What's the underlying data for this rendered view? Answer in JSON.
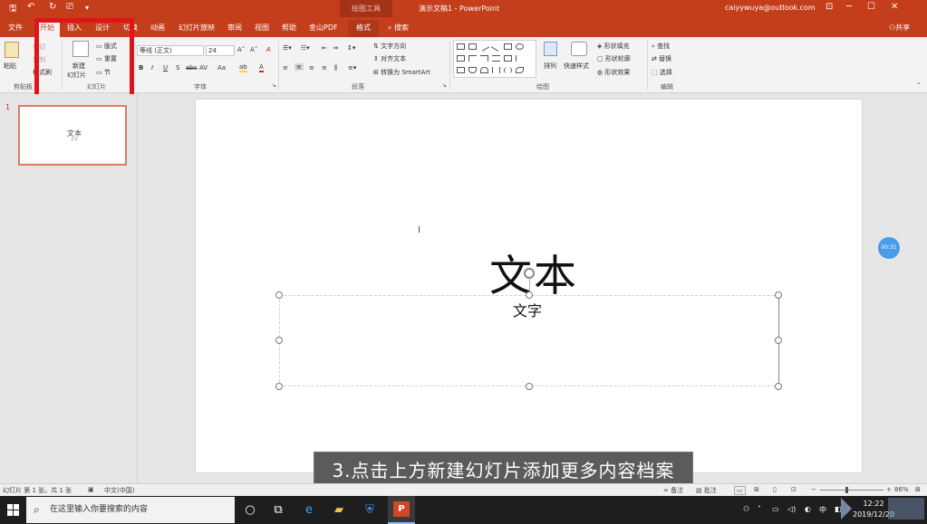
{
  "titlebar": {
    "quick_access": [
      "🖫",
      "↶",
      "↻",
      "⎚",
      "▾"
    ],
    "context_title": "绘图工具",
    "document_title": "演示文稿1 - PowerPoint",
    "account": "caiyywuya@outlook.com",
    "window_buttons": [
      "⊡",
      "─",
      "☐",
      "✕"
    ]
  },
  "tabs": {
    "file": "文件",
    "home": "开始",
    "insert": "插入",
    "design": "设计",
    "transitions": "切换",
    "animations": "动画",
    "slideshow": "幻灯片放映",
    "review": "审阅",
    "view": "视图",
    "help": "帮助",
    "pdf": "金山PDF",
    "format": "格式",
    "tell_me": "搜索",
    "share": "共享"
  },
  "ribbon": {
    "clipboard": {
      "paste": "粘贴",
      "cut": "剪切",
      "copy": "复制",
      "format_painter": "格式刷",
      "label": "剪贴板"
    },
    "slides": {
      "new_slide_1": "新建",
      "new_slide_2": "幻灯片",
      "layout": "版式",
      "reset": "重置",
      "section": "节",
      "label": "幻灯片"
    },
    "font": {
      "font_name": "等线 (正文)",
      "font_size": "24",
      "bold": "B",
      "italic": "I",
      "underline": "U",
      "strike": "S",
      "spacing": "AV",
      "case": "Aa",
      "label": "字体"
    },
    "paragraph": {
      "text_direction": "文字方向",
      "align_text": "对齐文本",
      "smartart": "转换为 SmartArt",
      "label": "段落"
    },
    "drawing": {
      "arrange": "排列",
      "quick_styles": "快速样式",
      "shape_fill": "形状填充",
      "shape_outline": "形状轮廓",
      "shape_effects": "形状效果",
      "label": "绘图"
    },
    "editing": {
      "find": "查找",
      "replace": "替换",
      "select": "选择",
      "label": "编辑"
    }
  },
  "thumbnails": [
    {
      "number": "1",
      "title": "文本",
      "subtitle": "文字"
    }
  ],
  "slide": {
    "title": "文本",
    "body": "文字"
  },
  "timer_badge": "00:31",
  "caption": "3.点击上方新建幻灯片添加更多内容档案",
  "statusbar": {
    "slide_info": "幻灯片 第 1 张，共 1 张",
    "language": "中文(中国)",
    "notes": "备注",
    "comments": "批注",
    "zoom": "86%"
  },
  "taskbar": {
    "search_placeholder": "在这里输入你要搜索的内容",
    "tray_lang": "中",
    "time": "12:22",
    "date": "2019/12/20"
  },
  "colors": {
    "accent": "#c43e1c",
    "highlight": "#e0141b",
    "caption_bg": "#5b5b5b",
    "taskbar": "#1e1e1e"
  }
}
